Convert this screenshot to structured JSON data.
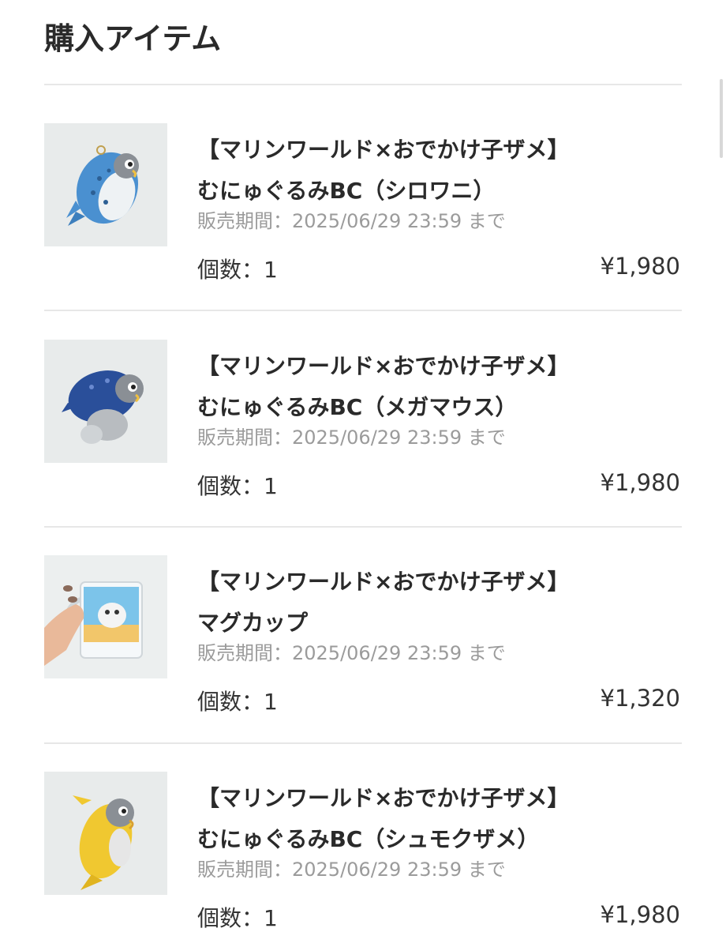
{
  "header": {
    "title": "購入アイテム"
  },
  "items": [
    {
      "title_line1": "【マリンワールド×おでかけ子ザメ】",
      "title_line2": "むにゅぐるみBC（シロワニ）",
      "period": "販売期間：2025/06/29 23:59 まで",
      "quantity": "個数：1",
      "price": "¥1,980",
      "image": "plush-shark-blue-spotted"
    },
    {
      "title_line1": "【マリンワールド×おでかけ子ザメ】",
      "title_line2": "むにゅぐるみBC（メガマウス）",
      "period": "販売期間：2025/06/29 23:59 まで",
      "quantity": "個数：1",
      "price": "¥1,980",
      "image": "plush-shark-dark-blue"
    },
    {
      "title_line1": "【マリンワールド×おでかけ子ザメ】",
      "title_line2": "マグカップ",
      "period": "販売期間：2025/06/29 23:59 まで",
      "quantity": "個数：1",
      "price": "¥1,320",
      "image": "mug-in-hand"
    },
    {
      "title_line1": "【マリンワールド×おでかけ子ザメ】",
      "title_line2": "むにゅぐるみBC（シュモクザメ）",
      "period": "販売期間：2025/06/29 23:59 まで",
      "quantity": "個数：1",
      "price": "¥1,980",
      "image": "plush-shark-yellow"
    }
  ]
}
